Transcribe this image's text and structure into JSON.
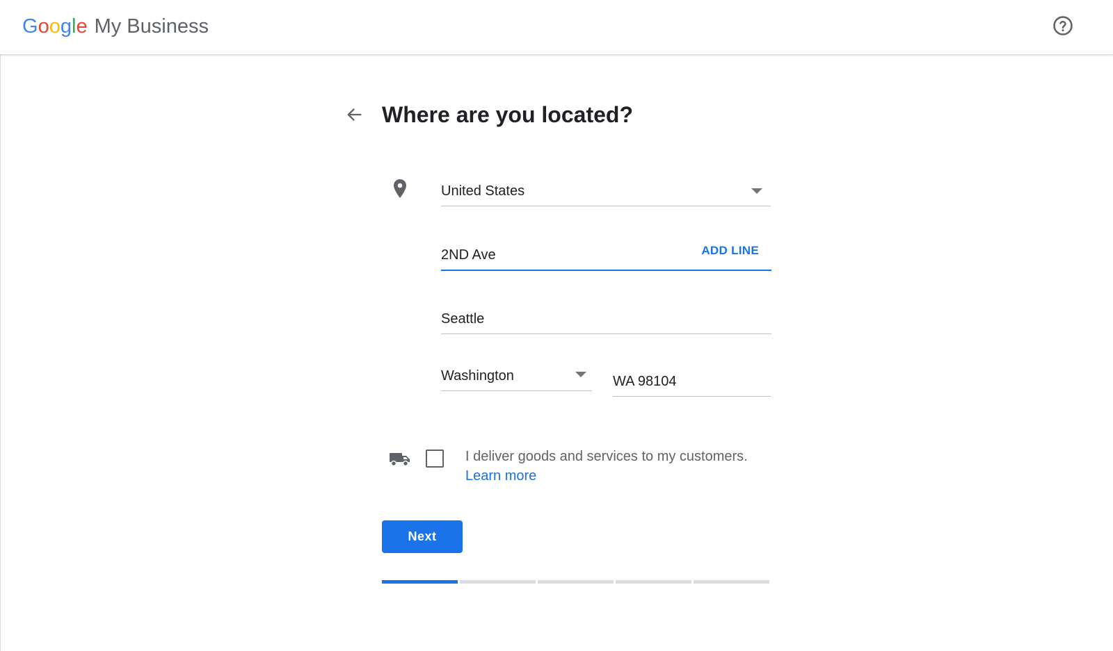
{
  "header": {
    "logo_letters": [
      {
        "char": "G",
        "color": "#4285F4"
      },
      {
        "char": "o",
        "color": "#EA4335"
      },
      {
        "char": "o",
        "color": "#FBBC05"
      },
      {
        "char": "g",
        "color": "#4285F4"
      },
      {
        "char": "l",
        "color": "#34A853"
      },
      {
        "char": "e",
        "color": "#EA4335"
      }
    ],
    "product_name": "My Business",
    "help_icon": "help-circle-icon"
  },
  "form": {
    "title": "Where are you located?",
    "back_icon": "arrow-back-icon",
    "location_icon": "location-pin-icon",
    "country": "United States",
    "street": "2ND Ave",
    "add_line_label": "ADD LINE",
    "city": "Seattle",
    "state": "Washington",
    "zip": "WA 98104",
    "delivery_icon": "truck-icon",
    "delivery_text": "I deliver goods and services to my customers.",
    "delivery_checked": false,
    "learn_more": "Learn more",
    "next_label": "Next"
  },
  "progress": {
    "total_steps": 5,
    "completed_steps": 1
  },
  "colors": {
    "accent": "#1a73e8",
    "text": "#202124",
    "secondary_text": "#5f6368",
    "divider": "#dadce0"
  }
}
